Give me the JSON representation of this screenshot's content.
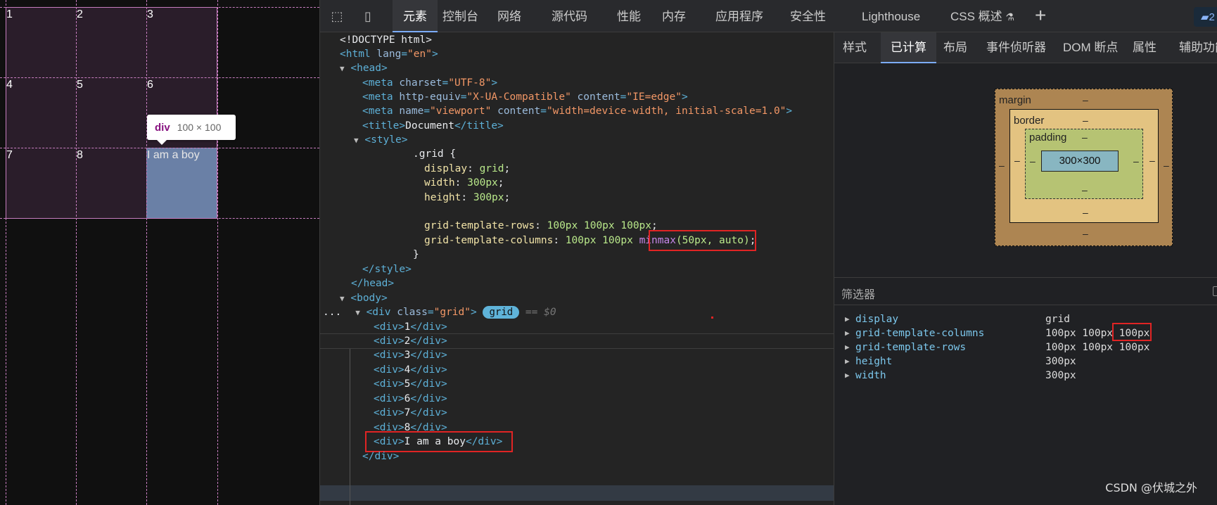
{
  "preview": {
    "cells": [
      "1",
      "2",
      "3",
      "4",
      "5",
      "6",
      "7",
      "8",
      "I am a boy"
    ],
    "tooltip": {
      "tag": "div",
      "dims": "100 × 100"
    }
  },
  "toolbar": {
    "tabs": [
      "元素",
      "控制台",
      "网络",
      "源代码",
      "性能",
      "内存",
      "应用程序",
      "安全性",
      "Lighthouse",
      "CSS 概述"
    ],
    "active_tab": "元素",
    "badge": "2"
  },
  "tree": {
    "lines": {
      "l1": "<!DOCTYPE html>",
      "l2_tag_open": "<html",
      "l2_attr": " lang",
      "l2_val": "\"en\"",
      "l3": "<head>",
      "l4_attr": " charset",
      "l4_val": "\"UTF-8\"",
      "l5_attr1": " http-equiv",
      "l5_val1": "\"X-UA-Compatible\"",
      "l5_attr2": " content",
      "l5_val2": "\"IE=edge\"",
      "l6_attr1": " name",
      "l6_val1": "\"viewport\"",
      "l6_attr2": " content",
      "l6_val2": "\"width=device-width, initial-scale=1.0\"",
      "l7_text": "Document",
      "l8": "<style>",
      "l9": ".grid {",
      "l10_p": "display",
      "l10_v": "grid",
      "l11_p": "width",
      "l11_v": "300px",
      "l12_p": "height",
      "l12_v": "300px",
      "l14_p": "grid-template-rows",
      "l14_v": "100px 100px 100px",
      "l15_p": "grid-template-columns",
      "l15_v": "100px 100px ",
      "l15_fn": "minmax",
      "l15_args": "(50px, auto)",
      "l16": "}",
      "l17": "</style>",
      "l18": "</head>",
      "l19": "<body>",
      "l20_dots": "...",
      "l20_attr": " class",
      "l20_val": "\"grid\"",
      "l20_badge": "grid",
      "l20_eq": "== $0",
      "children": [
        "1",
        "2",
        "3",
        "4",
        "5",
        "6",
        "7",
        "8",
        "I am a boy"
      ],
      "l30": "</div>"
    }
  },
  "subtabs": [
    "样式",
    "已计算",
    "布局",
    "事件侦听器",
    "DOM 断点",
    "属性",
    "辅助功能"
  ],
  "active_subtab": "已计算",
  "boxmodel": {
    "margin_label": "margin",
    "border_label": "border",
    "padding_label": "padding",
    "content": "300×300",
    "dash": "–"
  },
  "filter_label": "筛选器",
  "computed": [
    {
      "name": "display",
      "value": "grid"
    },
    {
      "name": "grid-template-columns",
      "value": "100px 100px ",
      "value_boxed": "100px"
    },
    {
      "name": "grid-template-rows",
      "value": "100px 100px 100px"
    },
    {
      "name": "height",
      "value": "300px"
    },
    {
      "name": "width",
      "value": "300px"
    }
  ],
  "watermark": "CSDN @伏城之外"
}
